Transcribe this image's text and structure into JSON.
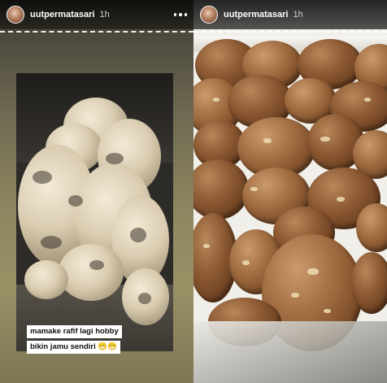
{
  "stories": [
    {
      "username": "uutpermatasari",
      "time": "1h",
      "caption_line1": "mamake rafif lagi hobby",
      "caption_line2": "bikin jamu sendiri 😁😁"
    },
    {
      "username": "uutpermatasari",
      "time": "1h"
    }
  ],
  "icons": {
    "more": "more-options-icon",
    "avatar": "avatar"
  }
}
